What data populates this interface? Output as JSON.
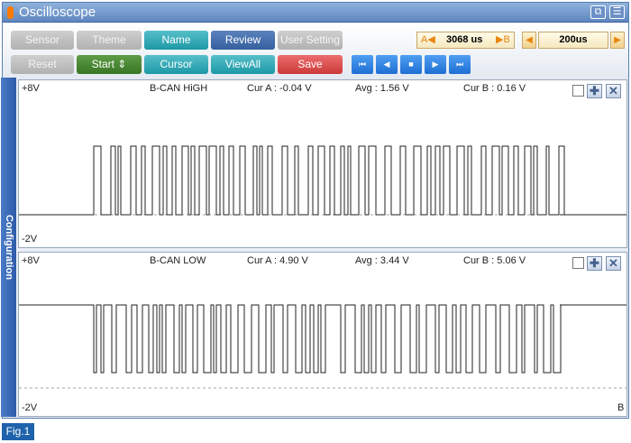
{
  "window": {
    "title": "Oscilloscope",
    "restore_glyph": "⧉",
    "menu_glyph": "☰"
  },
  "toolbar": {
    "sensor_label": "Sensor",
    "theme_label": "Theme",
    "name_label": "Name",
    "review_label": "Review",
    "user_setting_label": "User Setting",
    "reset_label": "Reset",
    "start_label": "Start ⇕",
    "cursor_label": "Cursor",
    "viewall_label": "ViewAll",
    "save_label": "Save",
    "playback": {
      "first": "⏮",
      "prev": "◀",
      "stop": "■",
      "next": "▶",
      "last": "⏭"
    },
    "cursor_delta": {
      "a_marker": "A◀",
      "value": "3068 us",
      "b_marker": "▶B"
    },
    "timebase": {
      "left_arrow": "◀",
      "value": "200us",
      "right_arrow": "▶"
    }
  },
  "sidebar": {
    "label": "Configuration"
  },
  "channels": [
    {
      "ymax_label": "+8V",
      "ymin_label": "-2V",
      "name": "B-CAN HiGH",
      "cur_a": "Cur A : -0.04 V",
      "avg": "Avg : 1.56 V",
      "cur_b": "Cur B : 0.16 V",
      "zoom_glyph": "✚",
      "close_glyph": "✕"
    },
    {
      "ymax_label": "+8V",
      "ymin_label": "-2V",
      "name": "B-CAN LOW",
      "cur_a": "Cur A : 4.90 V",
      "avg": "Avg : 3.44 V",
      "cur_b": "Cur B : 5.06 V",
      "zoom_glyph": "✚",
      "close_glyph": "✕",
      "b_marker": "B"
    }
  ],
  "figure_label": "Fig.1",
  "colors": {
    "accent_blue": "#2d5aa8",
    "teal": "#1d98a6",
    "green": "#3a7625",
    "red": "#cc3a3a",
    "trace": "#222222"
  }
}
